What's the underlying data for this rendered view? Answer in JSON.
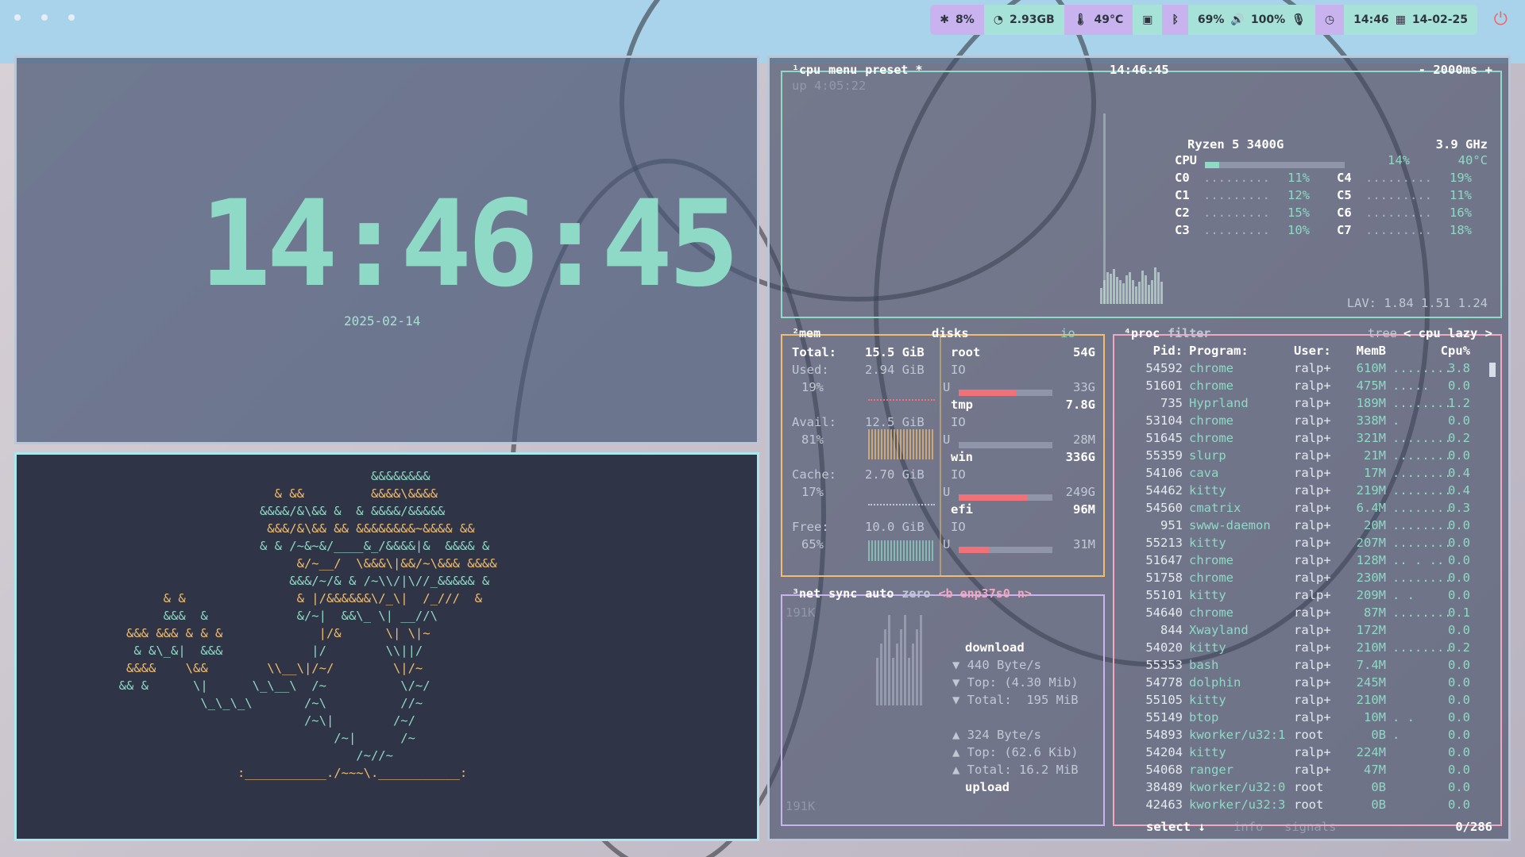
{
  "topbar": {
    "cpu": "8%",
    "memory": "2.93GB",
    "temperature": "49°C",
    "brightness": "69%",
    "volume": "100%",
    "time": "14:46",
    "date": "14-02-25"
  },
  "clock": {
    "time": "14:46:45",
    "date": "2025-02-14"
  },
  "ascii_art": {
    "lines": [
      "                                    &&&&&&&&",
      "                       & &&         &&&&\\&&&&",
      "                     &&&&/&\\&& &  & &&&&/&&&&&",
      "                      &&&/&\\&& && &&&&&&&&~&&&& &&",
      "                     & & /~&~&/____&_/&&&&|&  &&&& &",
      "                          &/~__/  \\&&&\\|&&/~\\&&& &&&&",
      "                         &&&/~/& & /~\\\\/|\\//_&&&&& &",
      "        & &               & |/&&&&&&\\/_\\|  /_///  &",
      "        &&&  &            &/~|  &&\\_ \\| __//\\",
      "   &&& &&& & & &             |/&      \\| \\|~",
      "    & &\\_&|  &&&            |/        \\\\||/",
      "   &&&&    \\&&        \\\\__\\|/~/        \\|/~",
      "  && &      \\|      \\_\\__\\  /~          \\/~/",
      "             \\_\\_\\_\\       /~\\          //~",
      "                           /~\\|        /~/",
      "                               /~|      /~",
      "                                  /~//~",
      "                  :___________./~~~\\.___________:"
    ]
  },
  "btop": {
    "cpu": {
      "header": [
        "¹cpu",
        "menu",
        "preset *"
      ],
      "time": "14:46:45",
      "interval": "- 2000ms +",
      "uptime": "up 4:05:22",
      "model": "Ryzen 5 3400G",
      "freq": "3.9 GHz",
      "total_label": "CPU",
      "total_pct": "14%",
      "total_temp": "40°C",
      "cores": [
        {
          "name": "C0",
          "pct": "11%"
        },
        {
          "name": "C1",
          "pct": "12%"
        },
        {
          "name": "C2",
          "pct": "15%"
        },
        {
          "name": "C3",
          "pct": "10%"
        },
        {
          "name": "C4",
          "pct": "19%"
        },
        {
          "name": "C5",
          "pct": "11%"
        },
        {
          "name": "C6",
          "pct": "16%"
        },
        {
          "name": "C7",
          "pct": "18%"
        }
      ],
      "lav": "LAV: 1.84 1.51 1.24"
    },
    "mem": {
      "header": "²mem",
      "total_label": "Total:",
      "total": "15.5 GiB",
      "used_label": "Used:",
      "used": "2.94 GiB",
      "used_pct": "19%",
      "avail_label": "Avail:",
      "avail": "12.5 GiB",
      "avail_pct": "81%",
      "cache_label": "Cache:",
      "cache": "2.70 GiB",
      "cache_pct": "17%",
      "free_label": "Free:",
      "free": "10.0 GiB",
      "free_pct": "65%"
    },
    "disks": {
      "header": "disks",
      "io": "io",
      "items": [
        {
          "name": "root",
          "size": "54G",
          "used": "33G",
          "used_frac": 0.61
        },
        {
          "name": "tmp",
          "size": "7.8G",
          "used": "28M",
          "used_frac": 0.0
        },
        {
          "name": "win",
          "size": "336G",
          "used": "249G",
          "used_frac": 0.74
        },
        {
          "name": "efi",
          "size": "96M",
          "used": "31M",
          "used_frac": 0.32
        }
      ],
      "io_label": "IO",
      "u_label": "U"
    },
    "net": {
      "header": [
        "³net",
        "sync",
        "auto",
        "zero",
        "<b enp37s0 n>"
      ],
      "scale_top": "191K",
      "scale_bottom": "191K",
      "download_label": "download",
      "down_rate": "▼ 440 Byte/s",
      "down_top": "▼ Top: (4.30 Mib)",
      "down_total": "▼ Total:  195 MiB",
      "up_rate": "▲ 324 Byte/s",
      "up_top": "▲ Top: (62.6 Kib)",
      "up_total": "▲ Total: 16.2 MiB",
      "upload_label": "upload"
    },
    "proc": {
      "header": [
        "⁴proc",
        "filter"
      ],
      "header_right": [
        "tree",
        "< cpu lazy >"
      ],
      "columns": [
        "Pid:",
        "Program:",
        "User:",
        "MemB",
        "Cpu%"
      ],
      "rows": [
        {
          "pid": "54592",
          "prog": "chrome",
          "user": "ralp+",
          "mem": "610M",
          "cpu": "3.8"
        },
        {
          "pid": "51601",
          "prog": "chrome",
          "user": "ralp+",
          "mem": "475M",
          "cpu": "0.0"
        },
        {
          "pid": "735",
          "prog": "Hyprland",
          "user": "ralp+",
          "mem": "189M",
          "cpu": "1.2"
        },
        {
          "pid": "53104",
          "prog": "chrome",
          "user": "ralp+",
          "mem": "338M",
          "cpu": "0.0"
        },
        {
          "pid": "51645",
          "prog": "chrome",
          "user": "ralp+",
          "mem": "321M",
          "cpu": "0.2"
        },
        {
          "pid": "55359",
          "prog": "slurp",
          "user": "ralp+",
          "mem": "21M",
          "cpu": "0.0"
        },
        {
          "pid": "54106",
          "prog": "cava",
          "user": "ralp+",
          "mem": "17M",
          "cpu": "0.4"
        },
        {
          "pid": "54462",
          "prog": "kitty",
          "user": "ralp+",
          "mem": "219M",
          "cpu": "0.4"
        },
        {
          "pid": "54560",
          "prog": "cmatrix",
          "user": "ralp+",
          "mem": "6.4M",
          "cpu": "0.3"
        },
        {
          "pid": "951",
          "prog": "swww-daemon",
          "user": "ralp+",
          "mem": "20M",
          "cpu": "0.0"
        },
        {
          "pid": "55213",
          "prog": "kitty",
          "user": "ralp+",
          "mem": "207M",
          "cpu": "0.0"
        },
        {
          "pid": "51647",
          "prog": "chrome",
          "user": "ralp+",
          "mem": "128M",
          "cpu": "0.0"
        },
        {
          "pid": "51758",
          "prog": "chrome",
          "user": "ralp+",
          "mem": "230M",
          "cpu": "0.0"
        },
        {
          "pid": "55101",
          "prog": "kitty",
          "user": "ralp+",
          "mem": "209M",
          "cpu": "0.0"
        },
        {
          "pid": "54640",
          "prog": "chrome",
          "user": "ralp+",
          "mem": "87M",
          "cpu": "0.1"
        },
        {
          "pid": "844",
          "prog": "Xwayland",
          "user": "ralp+",
          "mem": "172M",
          "cpu": "0.0"
        },
        {
          "pid": "54020",
          "prog": "kitty",
          "user": "ralp+",
          "mem": "210M",
          "cpu": "0.2"
        },
        {
          "pid": "55353",
          "prog": "bash",
          "user": "ralp+",
          "mem": "7.4M",
          "cpu": "0.0"
        },
        {
          "pid": "54778",
          "prog": "dolphin",
          "user": "ralp+",
          "mem": "245M",
          "cpu": "0.0"
        },
        {
          "pid": "55105",
          "prog": "kitty",
          "user": "ralp+",
          "mem": "210M",
          "cpu": "0.0"
        },
        {
          "pid": "55149",
          "prog": "btop",
          "user": "ralp+",
          "mem": "10M",
          "cpu": "0.0"
        },
        {
          "pid": "54893",
          "prog": "kworker/u32:1",
          "user": "root",
          "mem": "0B",
          "cpu": "0.0"
        },
        {
          "pid": "54204",
          "prog": "kitty",
          "user": "ralp+",
          "mem": "224M",
          "cpu": "0.0"
        },
        {
          "pid": "54068",
          "prog": "ranger",
          "user": "ralp+",
          "mem": "47M",
          "cpu": "0.0"
        },
        {
          "pid": "38489",
          "prog": "kworker/u32:0",
          "user": "root",
          "mem": "0B",
          "cpu": "0.0"
        },
        {
          "pid": "42463",
          "prog": "kworker/u32:3",
          "user": "root",
          "mem": "0B",
          "cpu": "0.0"
        }
      ],
      "footer_select": "select ↓",
      "footer_info": "info",
      "footer_signals": "signals",
      "count": "0/286"
    }
  },
  "colors": {
    "accent_teal": "#8fd9c7",
    "accent_purple": "#c8b3ef",
    "accent_orange": "#f2bd6e",
    "accent_pink": "#f2a6c0",
    "power_red": "#e86a6a"
  }
}
